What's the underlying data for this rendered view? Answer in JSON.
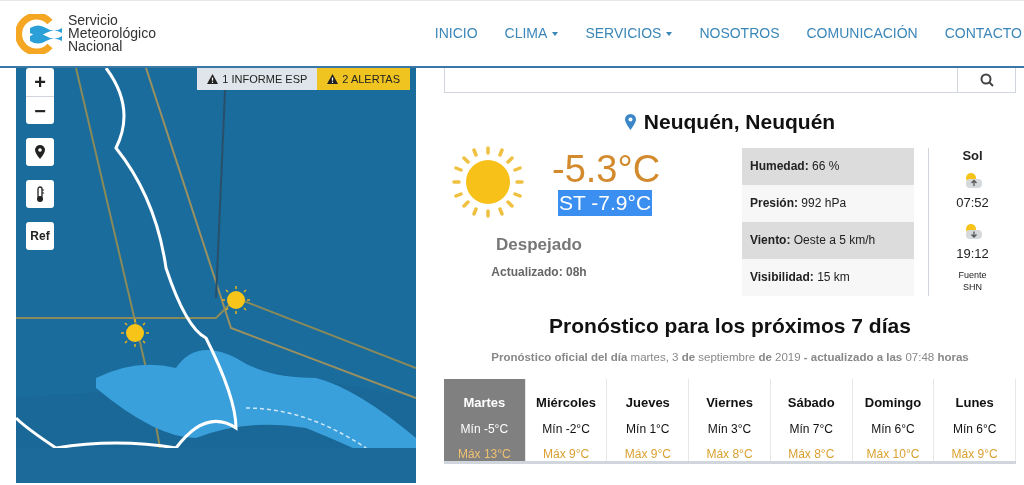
{
  "header": {
    "logo_text": "Servicio Meteorológico Nacional",
    "nav": [
      {
        "label": "INICIO",
        "dropdown": false
      },
      {
        "label": "CLIMA",
        "dropdown": true
      },
      {
        "label": "SERVICIOS",
        "dropdown": true
      },
      {
        "label": "NOSOTROS",
        "dropdown": false
      },
      {
        "label": "COMUNICACIÓN",
        "dropdown": false
      },
      {
        "label": "CONTACTO",
        "dropdown": false
      }
    ]
  },
  "map": {
    "controls": [
      {
        "kind": "zoom-in",
        "label": "+"
      },
      {
        "kind": "zoom-out",
        "label": "−"
      },
      {
        "kind": "location"
      },
      {
        "kind": "temperature"
      },
      {
        "kind": "text",
        "label": "Ref"
      }
    ],
    "badges": [
      {
        "label": "1 INFORME ESP",
        "color": "#dfe5ea"
      },
      {
        "label": "2 ALERTAS",
        "color": "#f0c420"
      }
    ]
  },
  "current": {
    "location": "Neuquén, Neuquén",
    "temperature": "-5.3°C",
    "feels_like": {
      "text": "ST -7.9°C",
      "highlighted": true
    },
    "condition": "Despejado",
    "updated": "Actualizado: 08h",
    "details": [
      {
        "text": "**Humedad:** 66 %",
        "shaded": true
      },
      {
        "text": "**Presión:** 992 hPa",
        "shaded": false
      },
      {
        "text": "**Viento:** Oeste a 5 km/h",
        "shaded": true
      },
      {
        "text": "**Visibilidad:** 15 km",
        "shaded": false
      }
    ],
    "sun": {
      "title": "Sol",
      "sunrise": "07:52",
      "sunset": "19:12",
      "source": "Fuente SHN"
    }
  },
  "forecast": {
    "title": "Pronóstico para los próximos 7 días",
    "subtitle": "**Pronóstico oficial del día** martes, 3 **de** septiembre **de** 2019 **- actualizado a las** 07:48 **horas**",
    "days": [
      {
        "day": "Martes",
        "min": "Mín -5°C",
        "max": "Máx 13°C",
        "selected": true
      },
      {
        "day": "Miércoles",
        "min": "Mín -2°C",
        "max": "Máx 9°C",
        "selected": false
      },
      {
        "day": "Jueves",
        "min": "Mín 1°C",
        "max": "Máx 9°C",
        "selected": false
      },
      {
        "day": "Viernes",
        "min": "Mín 3°C",
        "max": "Máx 8°C",
        "selected": false
      },
      {
        "day": "Sábado",
        "min": "Mín 7°C",
        "max": "Máx 8°C",
        "selected": false
      },
      {
        "day": "Domingo",
        "min": "Mín 6°C",
        "max": "Máx 10°C",
        "selected": false
      },
      {
        "day": "Lunes",
        "min": "Mín 6°C",
        "max": "Máx 9°C",
        "selected": false
      }
    ]
  }
}
